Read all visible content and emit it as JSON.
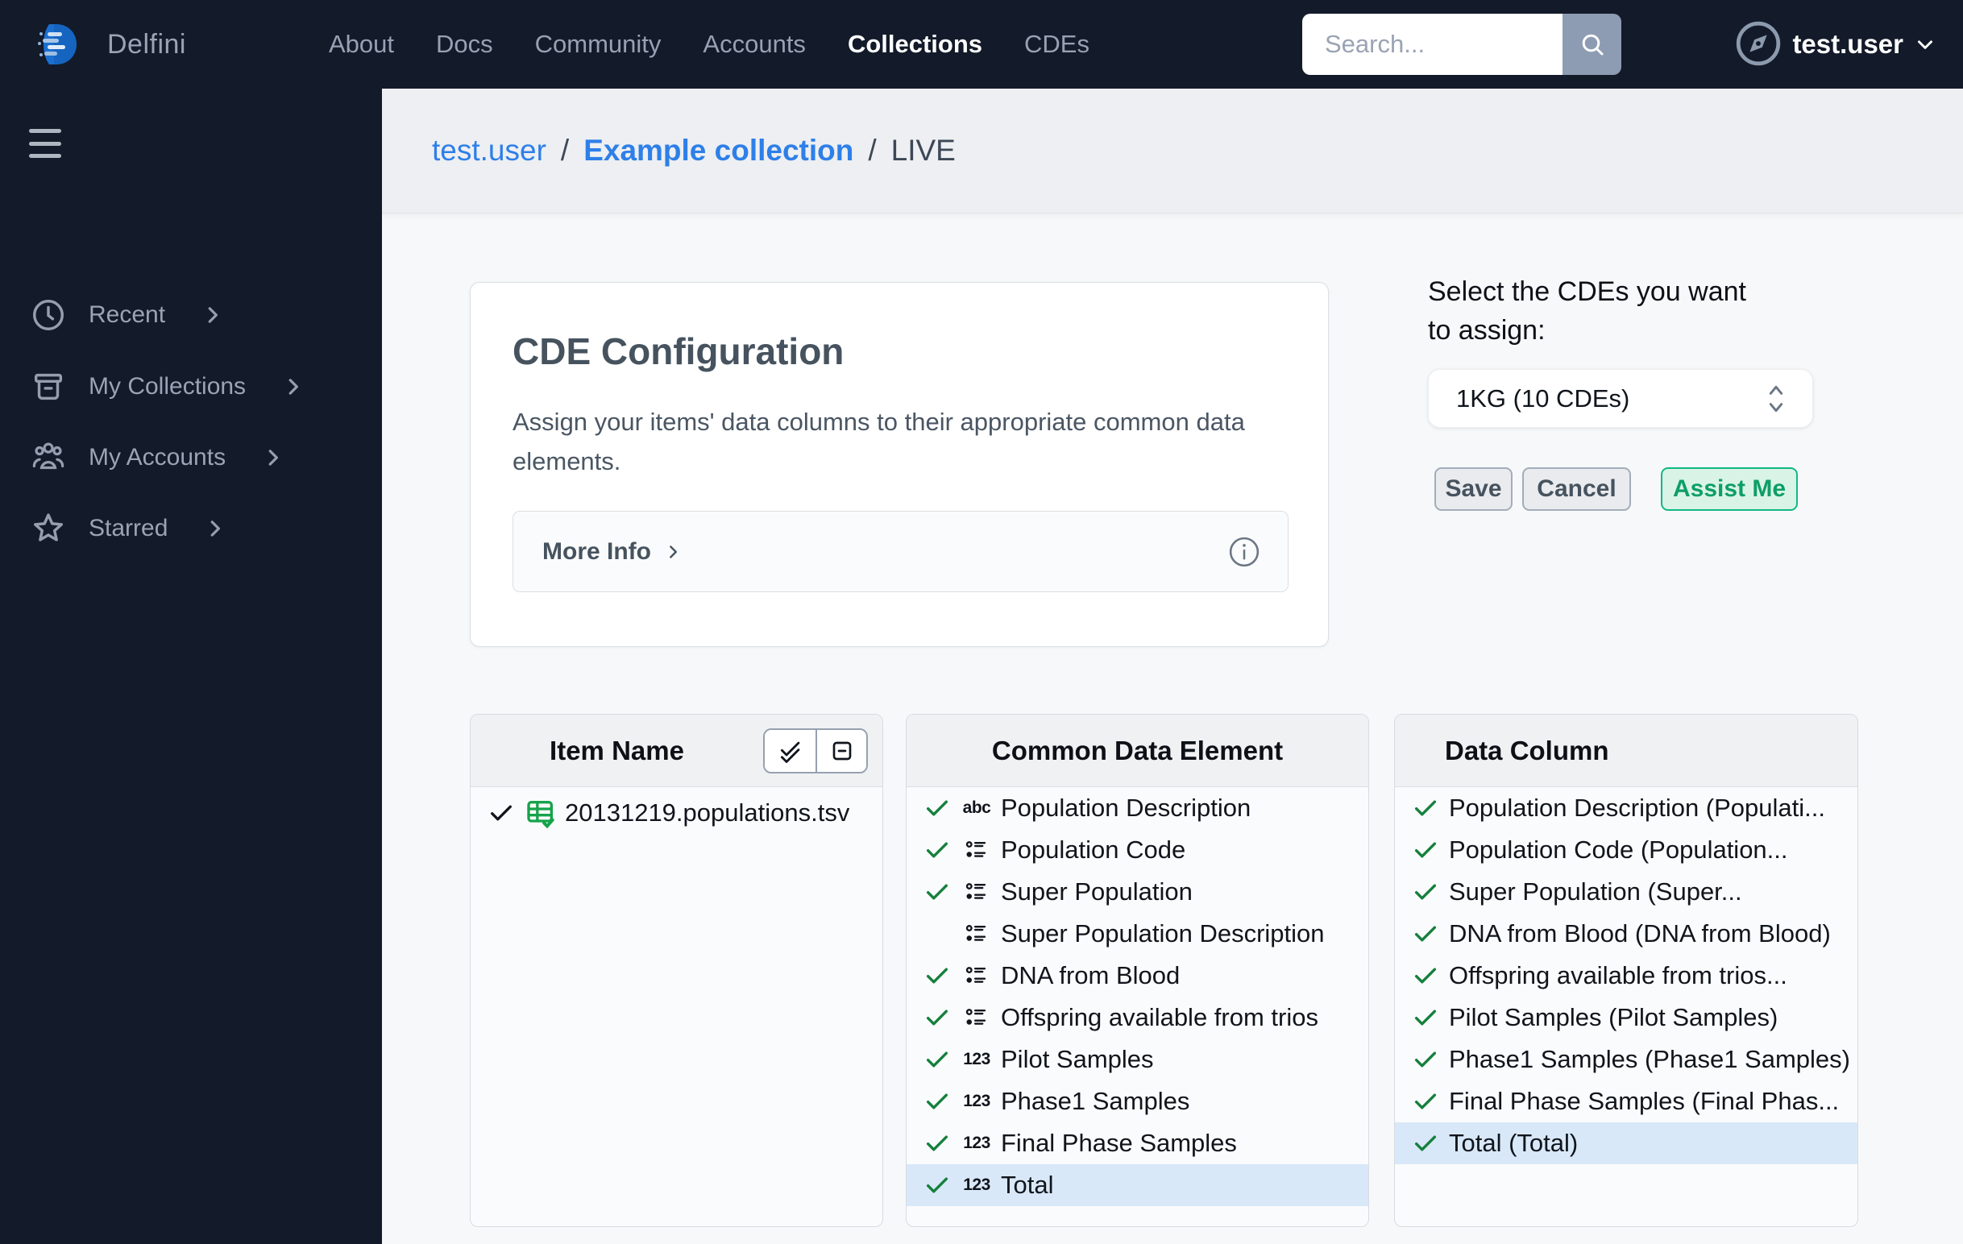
{
  "topbar": {
    "brand": "Delfini",
    "nav": [
      {
        "label": "About",
        "active": false
      },
      {
        "label": "Docs",
        "active": false
      },
      {
        "label": "Community",
        "active": false
      },
      {
        "label": "Accounts",
        "active": false
      },
      {
        "label": "Collections",
        "active": true
      },
      {
        "label": "CDEs",
        "active": false
      }
    ],
    "search_placeholder": "Search...",
    "user": "test.user"
  },
  "sidebar": {
    "items": [
      {
        "label": "Recent"
      },
      {
        "label": "My Collections"
      },
      {
        "label": "My Accounts"
      },
      {
        "label": "Starred"
      }
    ]
  },
  "breadcrumb": {
    "user": "test.user",
    "separator": "/",
    "collection": "Example collection",
    "status": "LIVE"
  },
  "config_card": {
    "title": "CDE Configuration",
    "description": "Assign your items' data columns to their appropriate common data elements.",
    "more_info_label": "More Info"
  },
  "assign": {
    "label": "Select the CDEs you want to assign:",
    "select_value": "1KG (10 CDEs)",
    "save_label": "Save",
    "cancel_label": "Cancel",
    "assist_label": "Assist Me"
  },
  "panels": {
    "item_name": {
      "title": "Item Name",
      "rows": [
        {
          "checked": true,
          "name": "20131219.populations.tsv"
        }
      ]
    },
    "cde": {
      "title": "Common Data Element",
      "rows": [
        {
          "checked": true,
          "type": "abc",
          "label": "Population Description"
        },
        {
          "checked": true,
          "type": "enum",
          "label": "Population Code"
        },
        {
          "checked": true,
          "type": "enum",
          "label": "Super Population"
        },
        {
          "checked": false,
          "type": "enum",
          "label": "Super Population Description"
        },
        {
          "checked": true,
          "type": "enum",
          "label": "DNA from Blood"
        },
        {
          "checked": true,
          "type": "enum",
          "label": "Offspring available from trios"
        },
        {
          "checked": true,
          "type": "123",
          "label": "Pilot Samples"
        },
        {
          "checked": true,
          "type": "123",
          "label": "Phase1 Samples"
        },
        {
          "checked": true,
          "type": "123",
          "label": "Final Phase Samples"
        },
        {
          "checked": true,
          "type": "123",
          "label": "Total",
          "selected": true
        }
      ]
    },
    "data_column": {
      "title": "Data Column",
      "rows": [
        {
          "checked": true,
          "label": "Population Description (Populati..."
        },
        {
          "checked": true,
          "label": "Population Code (Population..."
        },
        {
          "checked": true,
          "label": "Super Population (Super..."
        },
        {
          "checked": true,
          "label": "DNA from Blood (DNA from Blood)"
        },
        {
          "checked": true,
          "label": "Offspring available from trios..."
        },
        {
          "checked": true,
          "label": "Pilot Samples (Pilot Samples)"
        },
        {
          "checked": true,
          "label": "Phase1 Samples (Phase1 Samples)"
        },
        {
          "checked": true,
          "label": "Final Phase Samples (Final Phas..."
        },
        {
          "checked": true,
          "label": "Total (Total)",
          "selected": true
        }
      ]
    }
  },
  "colors": {
    "navy": "#131a29",
    "accent_blue": "#2e7fe8",
    "check_green": "#15803d",
    "file_icon_green": "#16a34a",
    "assist_bg": "#d9f4e6",
    "assist_border": "#10b981",
    "assist_text": "#0d9e66",
    "selected_row": "#d9e8f8"
  }
}
